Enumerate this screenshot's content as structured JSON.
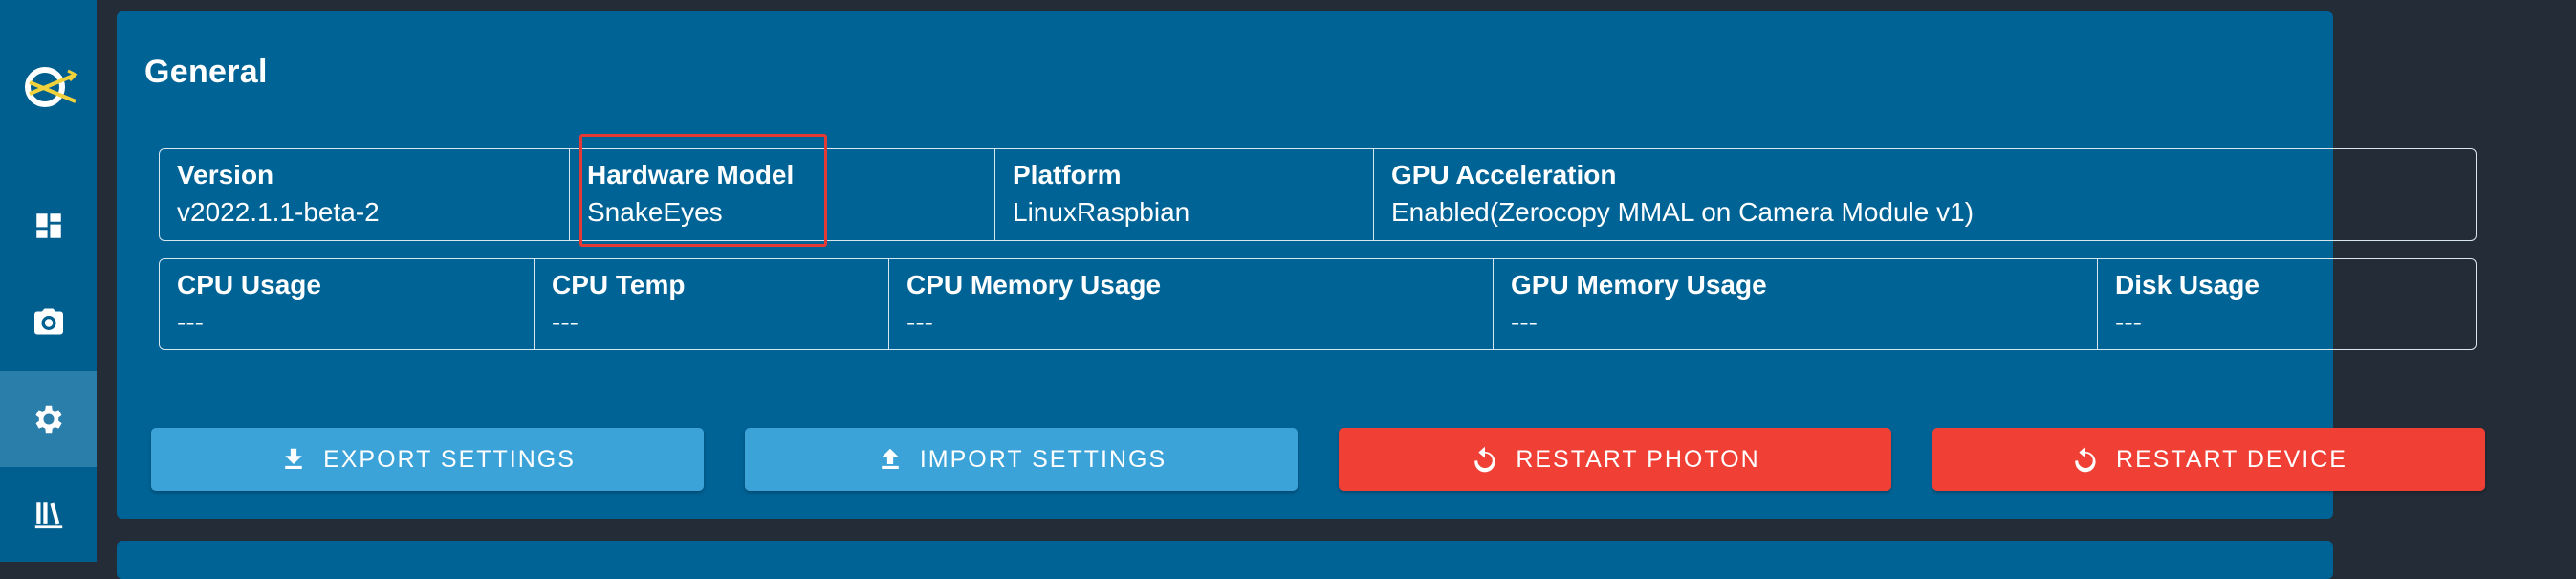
{
  "nav": {
    "items": [
      {
        "name": "dashboard",
        "icon": "dashboard-icon"
      },
      {
        "name": "cameras",
        "icon": "camera-icon"
      },
      {
        "name": "settings",
        "icon": "gear-icon",
        "active": true
      },
      {
        "name": "docs",
        "icon": "library-icon"
      }
    ]
  },
  "general": {
    "title": "General",
    "row1": [
      {
        "label": "Version",
        "value": "v2022.1.1-beta-2"
      },
      {
        "label": "Hardware Model",
        "value": "SnakeEyes"
      },
      {
        "label": "Platform",
        "value": "LinuxRaspbian"
      },
      {
        "label": "GPU Acceleration",
        "value": "Enabled(Zerocopy MMAL on Camera Module v1)"
      }
    ],
    "row2": [
      {
        "label": "CPU Usage",
        "value": "---"
      },
      {
        "label": "CPU Temp",
        "value": "---"
      },
      {
        "label": "CPU Memory Usage",
        "value": "---"
      },
      {
        "label": "GPU Memory Usage",
        "value": "---"
      },
      {
        "label": "Disk Usage",
        "value": "---"
      }
    ]
  },
  "actions": {
    "export": {
      "label": "EXPORT SETTINGS",
      "icon": "download-icon"
    },
    "import": {
      "label": "IMPORT SETTINGS",
      "icon": "upload-icon"
    },
    "restart_photon": {
      "label": "RESTART PHOTON",
      "icon": "restart-icon"
    },
    "restart_device": {
      "label": "RESTART DEVICE",
      "icon": "restart-icon"
    }
  },
  "colors": {
    "rail": "#005f8f",
    "card": "#006395",
    "button_blue": "#3ca3d8",
    "button_red": "#f04036",
    "highlight": "#e53935"
  }
}
